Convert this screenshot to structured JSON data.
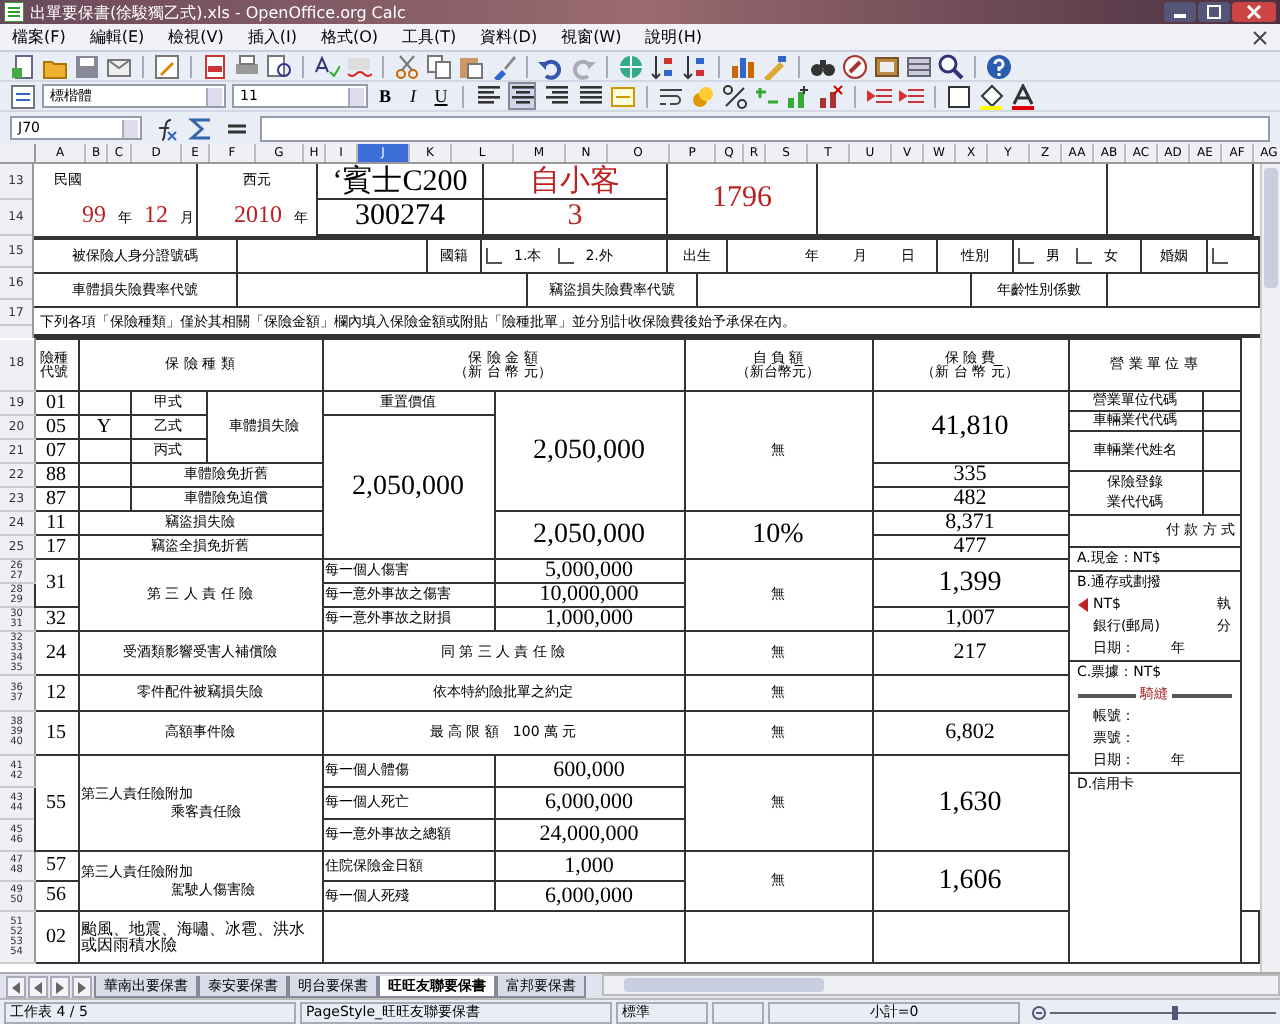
{
  "window": {
    "title": "出單要保書(徐駿獨乙式).xls - OpenOffice.org Calc"
  },
  "menu": [
    "檔案(F)",
    "編輯(E)",
    "檢視(V)",
    "插入(I)",
    "格式(O)",
    "工具(T)",
    "資料(D)",
    "視窗(W)",
    "說明(H)"
  ],
  "format_bar": {
    "font_name": "標楷體",
    "font_size": "11",
    "text_styles": [
      {
        "label": "B",
        "kind": "bold"
      },
      {
        "label": "I",
        "kind": "italic"
      },
      {
        "label": "U",
        "kind": "underline"
      }
    ],
    "alignments": [
      {
        "kind": "left",
        "selected": false
      },
      {
        "kind": "center",
        "selected": true
      },
      {
        "kind": "right",
        "selected": false
      },
      {
        "kind": "justify",
        "selected": false
      }
    ]
  },
  "formula_bar": {
    "cell_ref": "J70"
  },
  "columns": [
    {
      "label": "A",
      "selected": false
    },
    {
      "label": "B",
      "selected": false
    },
    {
      "label": "C",
      "selected": false
    },
    {
      "label": "D",
      "selected": false
    },
    {
      "label": "E",
      "selected": false
    },
    {
      "label": "F",
      "selected": false
    },
    {
      "label": "G",
      "selected": false
    },
    {
      "label": "H",
      "selected": false
    },
    {
      "label": "I",
      "selected": false
    },
    {
      "label": "J",
      "selected": true
    },
    {
      "label": "K",
      "selected": false
    },
    {
      "label": "L",
      "selected": false
    },
    {
      "label": "M",
      "selected": false
    },
    {
      "label": "N",
      "selected": false
    },
    {
      "label": "O",
      "selected": false
    },
    {
      "label": "P",
      "selected": false
    },
    {
      "label": "Q",
      "selected": false
    },
    {
      "label": "R",
      "selected": false
    },
    {
      "label": "S",
      "selected": false
    },
    {
      "label": "T",
      "selected": false
    },
    {
      "label": "U",
      "selected": false
    },
    {
      "label": "V",
      "selected": false
    },
    {
      "label": "W",
      "selected": false
    },
    {
      "label": "X",
      "selected": false
    },
    {
      "label": "Y",
      "selected": false
    },
    {
      "label": "Z",
      "selected": false
    },
    {
      "label": "AA",
      "selected": false
    },
    {
      "label": "AB",
      "selected": false
    },
    {
      "label": "AC",
      "selected": false
    },
    {
      "label": "AD",
      "selected": false
    },
    {
      "label": "AE",
      "selected": false
    },
    {
      "label": "AF",
      "selected": false
    },
    {
      "label": "AG",
      "selected": false
    }
  ],
  "top": {
    "row_numbers": [
      "13",
      "14",
      "15",
      "16",
      "17"
    ],
    "roc_label": "民國",
    "roc_year": "99",
    "year_unit": "年",
    "roc_month": "12",
    "month_unit": "月",
    "ad_label": "西元",
    "ad_year": "2010",
    "ad_year_unit": "年",
    "car_model": "‘賓士C200",
    "engine_no": "300274",
    "vehicle_type": "自小客",
    "seats": "3",
    "displacement": "1796",
    "id_label": "被保險人身分證號碼",
    "nationality_label": "國籍",
    "nationality_options": [
      {
        "label": "1.本",
        "checked": false
      },
      {
        "label": "2.外",
        "checked": false
      }
    ],
    "birth_label": "出生",
    "birth_parts": [
      "年",
      "月",
      "日"
    ],
    "sex_label": "性別",
    "sex_options": [
      {
        "label": "男",
        "checked": false
      },
      {
        "label": "女",
        "checked": false
      }
    ],
    "marriage_label": "婚姻",
    "marriage_checked": false,
    "body_rate_label": "車體損失險費率代號",
    "theft_rate_label": "竊盜損失險費率代號",
    "age_factor_label": "年齡性別係數",
    "notice": "下列各項「保險種類」僅於其相關「保險金額」欄內填入保險金額或附貼「險種批單」並分別計收保險費後始予承保在內。"
  },
  "coverage": {
    "row_numbers": [
      [
        "18"
      ],
      [
        "19"
      ],
      [
        "20"
      ],
      [
        "21"
      ],
      [
        "22"
      ],
      [
        "23"
      ],
      [
        "24"
      ],
      [
        "25"
      ],
      [
        "26",
        "27"
      ],
      [
        "28",
        "29"
      ],
      [
        "30",
        "31"
      ],
      [
        "32",
        "33",
        "34",
        "35"
      ],
      [
        "36",
        "37"
      ],
      [
        "38",
        "39",
        "40"
      ],
      [
        "41",
        "42"
      ],
      [
        "43",
        "44"
      ],
      [
        "45",
        "46"
      ],
      [
        "47",
        "48"
      ],
      [
        "49",
        "50"
      ],
      [
        "51",
        "52",
        "53",
        "54"
      ]
    ],
    "header": {
      "code": "險種代號",
      "type": "保 險 種 類",
      "amount": "保 險 金 額",
      "amount_unit": "（新 台 幣 元）",
      "deductible": "自 負 額",
      "deductible_unit": "（新台幣元）",
      "premium": "保 險 費",
      "premium_unit": "（新 台 幣 元）",
      "office": "營 業 單 位 專"
    },
    "body": {
      "codes": [
        "01",
        "05",
        "07"
      ],
      "plans": [
        {
          "label": "甲式"
        },
        {
          "label": "乙式",
          "mark": "Y"
        },
        {
          "label": "丙式"
        }
      ],
      "name": "車體損失險",
      "value_label": "重置價值",
      "value": "2,050,000",
      "amount": "2,050,000",
      "deductible": "無",
      "premium": "41,810"
    },
    "waivers": [
      {
        "code": "88",
        "name": "車體險免折舊",
        "premium": "335"
      },
      {
        "code": "87",
        "name": "車體險免追償",
        "premium": "482"
      }
    ],
    "theft": {
      "items": [
        {
          "code": "11",
          "name": "竊盜損失險",
          "premium": "8,371"
        },
        {
          "code": "17",
          "name": "竊盜全損免折舊",
          "premium": "477"
        }
      ],
      "amount": "2,050,000",
      "deductible": "10%"
    },
    "liability": {
      "codes": [
        "31",
        "32"
      ],
      "name": "第 三 人 責 任 險",
      "limits": [
        {
          "label": "每一個人傷害",
          "amount": "5,000,000"
        },
        {
          "label": "每一意外事故之傷害",
          "amount": "10,000,000"
        },
        {
          "label": "每一意外事故之財損",
          "amount": "1,000,000"
        }
      ],
      "deductible": "無",
      "premiums": [
        "1,399",
        "1,007"
      ]
    },
    "simple": [
      {
        "code": "24",
        "name": "受酒類影響受害人補償險",
        "amount": "同 第 三 人 責 任 險",
        "deductible": "無",
        "premium": "217"
      },
      {
        "code": "12",
        "name": "零件配件被竊損失險",
        "amount": "依本特約險批單之約定",
        "deductible": "無"
      },
      {
        "code": "15",
        "name": "高額事件險",
        "amount": "最 高 限 額　100 萬 元",
        "deductible": "無",
        "premium": "6,802"
      }
    ],
    "passenger": {
      "code": "55",
      "name_lines": [
        "第三人責任險附加",
        "乘客責任險"
      ],
      "limits": [
        {
          "label": "每一個人體傷",
          "amount": "600,000"
        },
        {
          "label": "每一個人死亡",
          "amount": "6,000,000"
        },
        {
          "label": "每一意外事故之總額",
          "amount": "24,000,000"
        }
      ],
      "deductible": "無",
      "premium": "1,630"
    },
    "driver": {
      "codes": [
        "57",
        "56"
      ],
      "name_lines": [
        "第三人責任險附加",
        "駕駛人傷害險"
      ],
      "limits": [
        {
          "label": "住院保險金日額",
          "amount": "1,000"
        },
        {
          "label": "每一個人死殘",
          "amount": "6,000,000"
        }
      ],
      "deductible": "無",
      "premium": "1,606"
    },
    "typhoon": {
      "code": "02",
      "name": "颱風、地震、海嘯、冰雹、洪水或因雨積水險"
    }
  },
  "office_panel": {
    "fields": [
      {
        "lines": [
          "營業單位代碼"
        ]
      },
      {
        "lines": [
          "車輛業代代碼"
        ]
      },
      {
        "lines": [
          "車輛業代姓名"
        ]
      },
      {
        "lines": [
          "保險登錄",
          "業代代碼"
        ]
      }
    ],
    "payment_title": "付 款 方 式",
    "cash": "A.現金：NT$",
    "transfer": "B.通存或劃撥",
    "transfer_amount": "NT$",
    "transfer_cut": "執",
    "bank": "銀行(郵局)",
    "bank_cut": "分",
    "date_label": "日期：",
    "year": "年",
    "cheque": "C.票據：NT$",
    "cheque_mark": "騎縫",
    "account": "帳號：",
    "cheque_no": "票號：",
    "cheque_date": "日期：",
    "cheque_year": "年",
    "card": "D.信用卡"
  },
  "sheet_tabs": [
    {
      "label": "華南出要保書",
      "selected": false
    },
    {
      "label": "泰安要保書",
      "selected": false
    },
    {
      "label": "明台要保書",
      "selected": false
    },
    {
      "label": "旺旺友聯要保書",
      "selected": true
    },
    {
      "label": "富邦要保書",
      "selected": false
    }
  ],
  "status_bar": {
    "sheet": "工作表 4 / 5",
    "page_style": "PageStyle_旺旺友聯要保書",
    "mode": "標準",
    "sum": "小計=0",
    "zoom_slider": {
      "level": 0.55
    }
  }
}
